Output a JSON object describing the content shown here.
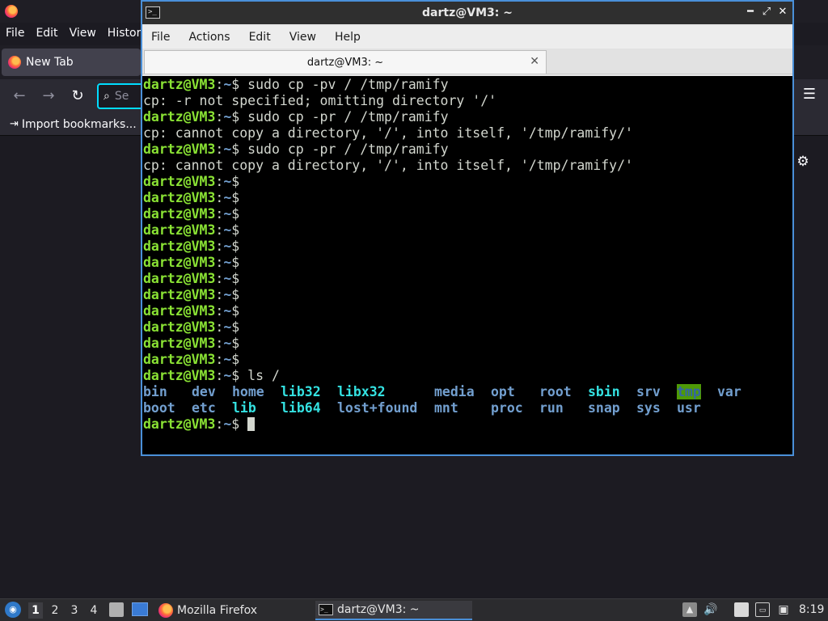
{
  "firefox": {
    "menus": [
      "File",
      "Edit",
      "View",
      "History"
    ],
    "tab_title": "New Tab",
    "search_placeholder": "Se",
    "bookmark": "Import bookmarks..."
  },
  "terminal": {
    "title": "dartz@VM3: ~",
    "menus": [
      "File",
      "Actions",
      "Edit",
      "View",
      "Help"
    ],
    "tab_title": "dartz@VM3: ~",
    "prompt": {
      "user": "dartz@VM3",
      "sep": ":",
      "path": "~",
      "symbol": "$"
    },
    "lines": [
      {
        "type": "cmd",
        "text": " sudo cp -pv / /tmp/ramify"
      },
      {
        "type": "out",
        "text": "cp: -r not specified; omitting directory '/'"
      },
      {
        "type": "cmd",
        "text": " sudo cp -pr / /tmp/ramify"
      },
      {
        "type": "out",
        "text": "cp: cannot copy a directory, '/', into itself, '/tmp/ramify/'"
      },
      {
        "type": "cmd",
        "text": " sudo cp -pr / /tmp/ramify"
      },
      {
        "type": "out",
        "text": "cp: cannot copy a directory, '/', into itself, '/tmp/ramify/'"
      },
      {
        "type": "cmd",
        "text": ""
      },
      {
        "type": "cmd",
        "text": ""
      },
      {
        "type": "cmd",
        "text": ""
      },
      {
        "type": "cmd",
        "text": ""
      },
      {
        "type": "cmd",
        "text": ""
      },
      {
        "type": "cmd",
        "text": ""
      },
      {
        "type": "cmd",
        "text": ""
      },
      {
        "type": "cmd",
        "text": ""
      },
      {
        "type": "cmd",
        "text": ""
      },
      {
        "type": "cmd",
        "text": ""
      },
      {
        "type": "cmd",
        "text": ""
      },
      {
        "type": "cmd",
        "text": ""
      },
      {
        "type": "cmd",
        "text": " ls /"
      }
    ],
    "ls_rows": [
      [
        {
          "name": "bin",
          "color": "#729fcf",
          "bg": ""
        },
        {
          "name": "dev",
          "color": "#729fcf",
          "bg": ""
        },
        {
          "name": "home",
          "color": "#729fcf",
          "bg": ""
        },
        {
          "name": "lib32",
          "color": "#34e2e2",
          "bg": ""
        },
        {
          "name": "libx32",
          "color": "#34e2e2",
          "bg": ""
        },
        {
          "name": "media",
          "color": "#729fcf",
          "bg": ""
        },
        {
          "name": "opt",
          "color": "#729fcf",
          "bg": ""
        },
        {
          "name": "root",
          "color": "#729fcf",
          "bg": ""
        },
        {
          "name": "sbin",
          "color": "#34e2e2",
          "bg": ""
        },
        {
          "name": "srv",
          "color": "#729fcf",
          "bg": ""
        },
        {
          "name": "tmp",
          "color": "#3465a4",
          "bg": "#4e9a06"
        },
        {
          "name": "var",
          "color": "#729fcf",
          "bg": ""
        }
      ],
      [
        {
          "name": "boot",
          "color": "#729fcf",
          "bg": ""
        },
        {
          "name": "etc",
          "color": "#729fcf",
          "bg": ""
        },
        {
          "name": "lib",
          "color": "#34e2e2",
          "bg": ""
        },
        {
          "name": "lib64",
          "color": "#34e2e2",
          "bg": ""
        },
        {
          "name": "lost+found",
          "color": "#729fcf",
          "bg": ""
        },
        {
          "name": "mnt",
          "color": "#729fcf",
          "bg": ""
        },
        {
          "name": "proc",
          "color": "#729fcf",
          "bg": ""
        },
        {
          "name": "run",
          "color": "#729fcf",
          "bg": ""
        },
        {
          "name": "snap",
          "color": "#729fcf",
          "bg": ""
        },
        {
          "name": "sys",
          "color": "#729fcf",
          "bg": ""
        },
        {
          "name": "usr",
          "color": "#729fcf",
          "bg": ""
        },
        {
          "name": "",
          "color": "#729fcf",
          "bg": ""
        }
      ]
    ]
  },
  "taskbar": {
    "workspaces": [
      "1",
      "2",
      "3",
      "4"
    ],
    "active_workspace": "1",
    "tasks": [
      "Mozilla Firefox",
      "dartz@VM3: ~"
    ],
    "clock": "8:19"
  }
}
